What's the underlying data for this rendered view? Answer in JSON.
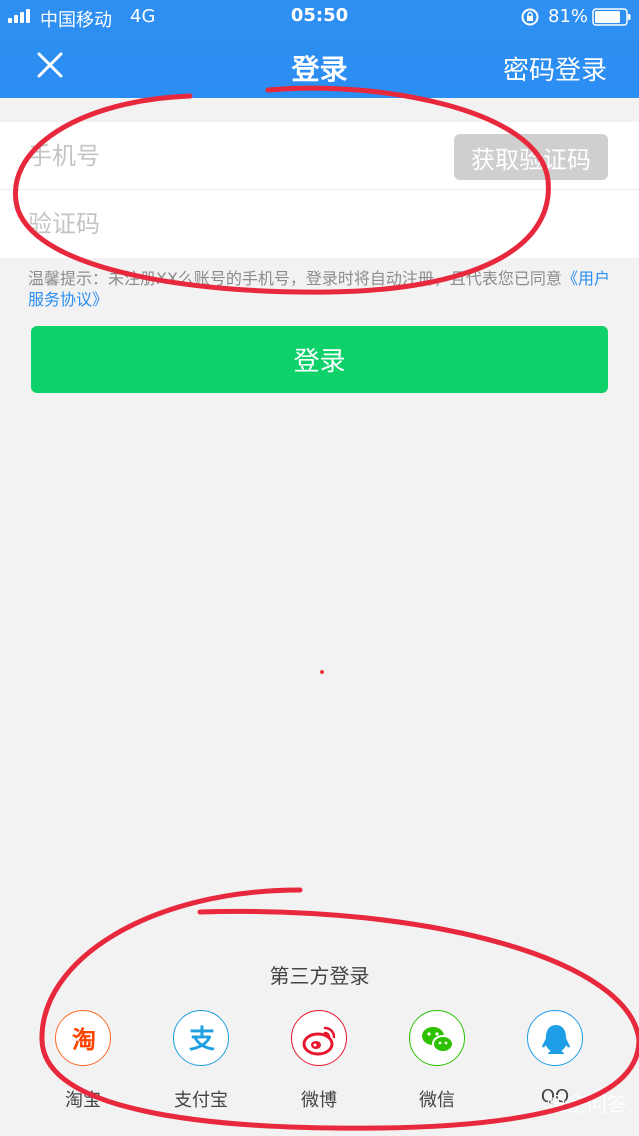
{
  "status_bar": {
    "carrier": "中国移动",
    "network": "4G",
    "time": "05:50",
    "battery": "81%"
  },
  "nav": {
    "title": "登录",
    "right_action": "密码登录",
    "close_icon": "close-icon"
  },
  "form": {
    "phone_placeholder": "手机号",
    "code_placeholder": "验证码",
    "get_code_label": "获取验证码"
  },
  "tips": {
    "text": "温馨提示：未注册XX么账号的手机号，登录时将自动注册，且代表您已同意",
    "link": "《用户服务协议》"
  },
  "login_button": "登录",
  "third_party": {
    "title": "第三方登录",
    "providers": [
      {
        "label": "淘宝",
        "icon": "taobao-icon",
        "glyph": "淘",
        "color": "#ff4400",
        "border": "#ff4400"
      },
      {
        "label": "支付宝",
        "icon": "alipay-icon",
        "glyph": "支",
        "color": "#1e9fe0",
        "border": "#1e9fe0"
      },
      {
        "label": "微博",
        "icon": "weibo-icon",
        "color": "#e6162d",
        "border": "#e6162d"
      },
      {
        "label": "微信",
        "icon": "wechat-icon",
        "color": "#2dc100",
        "border": "#2dc100"
      },
      {
        "label": "QQ",
        "icon": "qq-icon",
        "color": "#1d9ee6",
        "border": "#1d9ee6"
      }
    ]
  },
  "watermark": "悟空问答",
  "colors": {
    "header": "#2b8ef2",
    "login_button": "#0fd16a",
    "annotation": "#e8283c"
  }
}
